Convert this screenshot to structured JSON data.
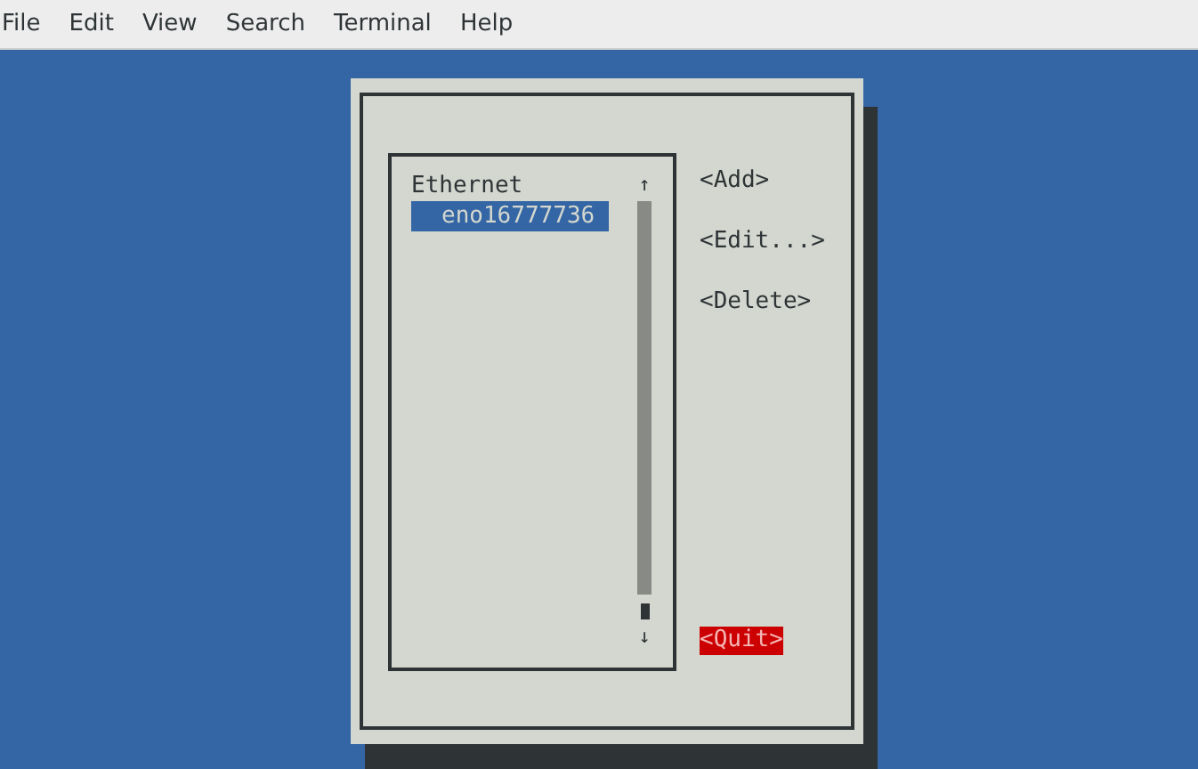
{
  "menu_bar": [
    "File",
    "Edit",
    "View",
    "Search",
    "Terminal",
    "Help"
  ],
  "connection_list": {
    "groups": [
      {
        "label": "Ethernet",
        "children": [
          {
            "label": "eno16777736",
            "selected": true
          }
        ]
      }
    ],
    "scroll_up": "↑",
    "scroll_down": "↓"
  },
  "buttons": [
    {
      "label": "<Add>",
      "selected": false
    },
    {
      "label": "<Edit...>",
      "selected": false
    },
    {
      "label": "<Delete>",
      "selected": false
    },
    {
      "label": "<Quit>",
      "selected": true
    }
  ]
}
